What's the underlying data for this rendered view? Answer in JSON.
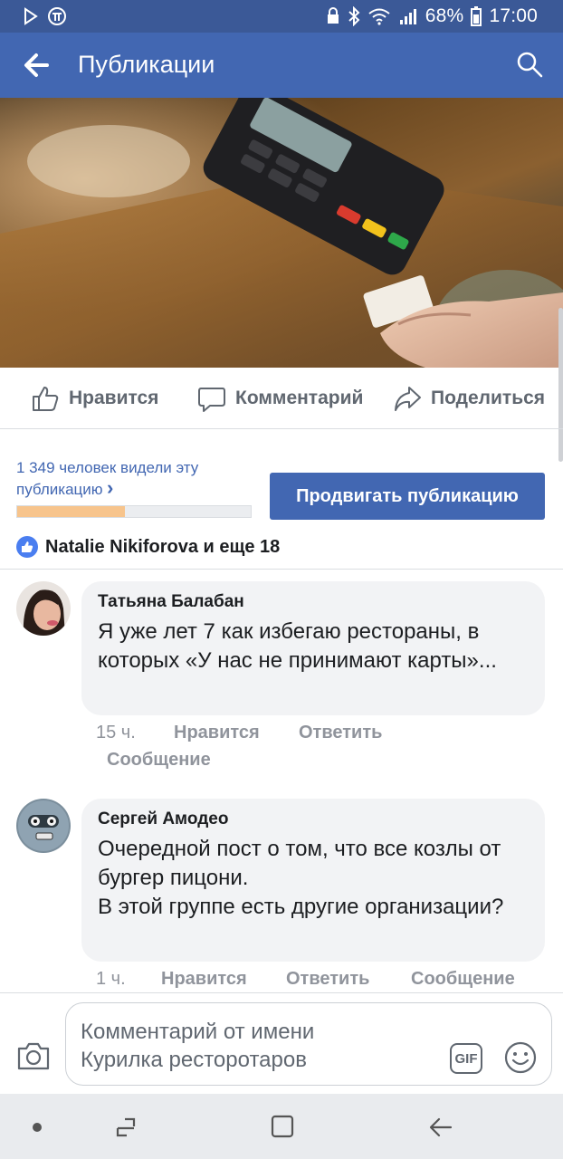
{
  "status_bar": {
    "battery": "68%",
    "time": "17:00"
  },
  "app_bar": {
    "title": "Публикации"
  },
  "actions": {
    "like": "Нравится",
    "comment": "Комментарий",
    "share": "Поделиться"
  },
  "stats": {
    "views_text": "1 349 человек видели эту публикацию",
    "chevron": "›",
    "progress_fraction": 0.46
  },
  "promote_button": "Продвигать публикацию",
  "reactions": {
    "text": "Natalie Nikiforova и еще 18"
  },
  "comments": [
    {
      "author": "Татьяна Балабан",
      "text": "Я уже лет 7 как избегаю рестораны, в которых «У нас не принимают карты»...",
      "time": "15 ч.",
      "like": "Нравится",
      "reply": "Ответить",
      "message": "Сообщение"
    },
    {
      "author": "Сергей Амодео",
      "text": "Очередной пост о том, что все козлы от бургер пицони.\nВ этой группе есть другие организации?",
      "time": "1 ч.",
      "like": "Нравится",
      "reply": "Ответить",
      "message": "Сообщение"
    }
  ],
  "composer": {
    "placeholder": "Комментарий от имени\nКурилка ресторотаров",
    "gif": "GIF"
  },
  "colors": {
    "brand": "#4267b2",
    "status_bar": "#3b5997",
    "progress": "#f7c48c"
  }
}
